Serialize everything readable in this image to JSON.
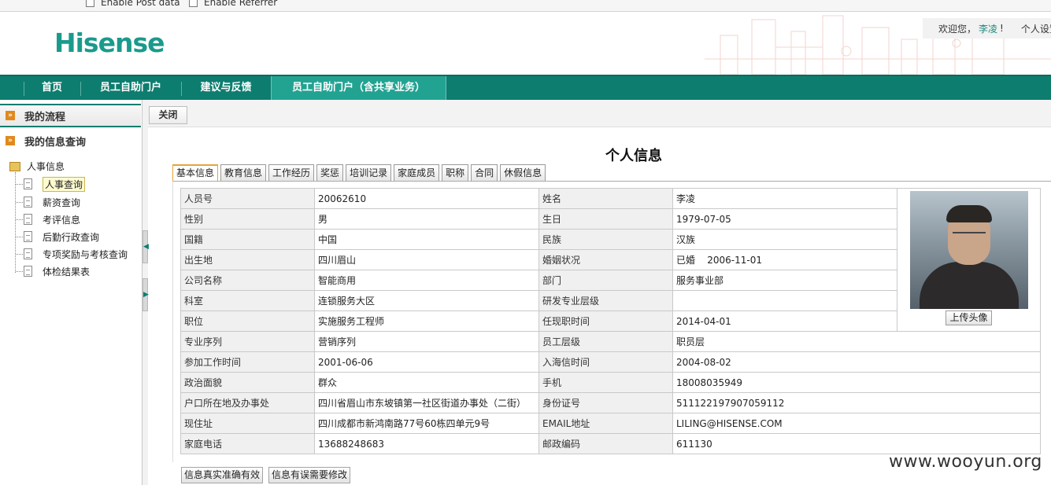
{
  "debug_bar": {
    "option1": "Enable Post data",
    "option2": "Enable Referrer"
  },
  "header": {
    "logo": "Hisense",
    "welcome_prefix": "欢迎您，",
    "username": "李凌",
    "welcome_suffix": "!",
    "settings": "个人设置"
  },
  "nav": {
    "items": [
      {
        "label": "首页"
      },
      {
        "label": "员工自助门户"
      },
      {
        "label": "建议与反馈"
      },
      {
        "label": "员工自助门户（含共享业务）"
      }
    ]
  },
  "sidebar": {
    "section1": "我的流程",
    "section2": "我的信息查询",
    "tree_root": "人事信息",
    "items": [
      {
        "label": "人事查询"
      },
      {
        "label": "薪资查询"
      },
      {
        "label": "考评信息"
      },
      {
        "label": "后勤行政查询"
      },
      {
        "label": "专项奖励与考核查询"
      },
      {
        "label": "体检结果表"
      }
    ]
  },
  "toolbar": {
    "close_label": "关闭"
  },
  "page_title": "个人信息",
  "tabs": [
    {
      "label": "基本信息"
    },
    {
      "label": "教育信息"
    },
    {
      "label": "工作经历"
    },
    {
      "label": "奖惩"
    },
    {
      "label": "培训记录"
    },
    {
      "label": "家庭成员"
    },
    {
      "label": "职称"
    },
    {
      "label": "合同"
    },
    {
      "label": "休假信息"
    }
  ],
  "info": {
    "rows": [
      {
        "k1": "人员号",
        "v1": "20062610",
        "k2": "姓名",
        "v2": "李凌"
      },
      {
        "k1": "性别",
        "v1": "男",
        "k2": "生日",
        "v2": "1979-07-05"
      },
      {
        "k1": "国籍",
        "v1": "中国",
        "k2": "民族",
        "v2": "汉族"
      },
      {
        "k1": "出生地",
        "v1": "四川眉山",
        "k2": "婚姻状况",
        "v2": "已婚    2006-11-01"
      },
      {
        "k1": "公司名称",
        "v1": "智能商用",
        "k2": "部门",
        "v2": "服务事业部"
      },
      {
        "k1": "科室",
        "v1": "连锁服务大区",
        "k2": "研发专业层级",
        "v2": ""
      },
      {
        "k1": "职位",
        "v1": "实施服务工程师",
        "k2": "任现职时间",
        "v2": "2014-04-01"
      },
      {
        "k1": "专业序列",
        "v1": "营销序列",
        "k2": "员工层级",
        "v2": "职员层"
      },
      {
        "k1": "参加工作时间",
        "v1": "2001-06-06",
        "k2": "入海信时间",
        "v2": "2004-08-02"
      },
      {
        "k1": "政治面貌",
        "v1": "群众",
        "k2": "手机",
        "v2": "18008035949"
      },
      {
        "k1": "户口所在地及办事处",
        "v1": "四川省眉山市东坡镇第一社区街道办事处（二街）",
        "k2": "身份证号",
        "v2": "511122197907059112"
      },
      {
        "k1": "现住址",
        "v1": "四川成都市新鸿南路77号60栋四单元9号",
        "k2": "EMAIL地址",
        "v2": "LILING@HISENSE.COM"
      },
      {
        "k1": "家庭电话",
        "v1": "13688248683",
        "k2": "邮政编码",
        "v2": "611130"
      }
    ],
    "upload_label": "上传头像"
  },
  "actions": {
    "confirm_label": "信息真实准确有效",
    "modify_label": "信息有误需要修改"
  },
  "watermark": "www.wooyun.org"
}
